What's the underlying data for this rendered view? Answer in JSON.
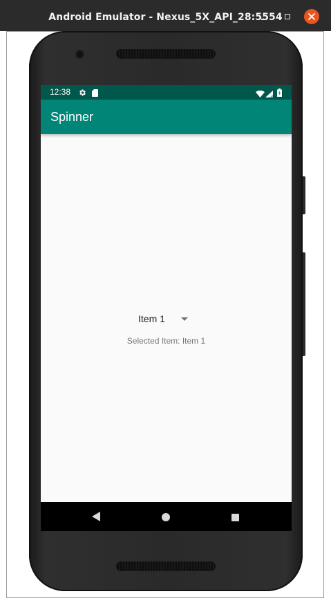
{
  "window": {
    "title": "Android Emulator - Nexus_5X_API_28:5554"
  },
  "status_bar": {
    "time": "12:38",
    "color": "#00574b"
  },
  "app_bar": {
    "title": "Spinner",
    "color": "#008577"
  },
  "spinner": {
    "selected_value": "Item 1"
  },
  "selected_label": "Selected Item: Item 1",
  "icons": {
    "status_left": [
      "gear-icon",
      "sd-card-icon"
    ],
    "status_right": [
      "wifi-icon",
      "signal-icon",
      "battery-icon"
    ],
    "nav": [
      "back-icon",
      "home-icon",
      "recent-apps-icon"
    ]
  },
  "colors": {
    "close_button": "#e95420",
    "screen_background": "#fafafa",
    "nav_bar": "#000000"
  }
}
